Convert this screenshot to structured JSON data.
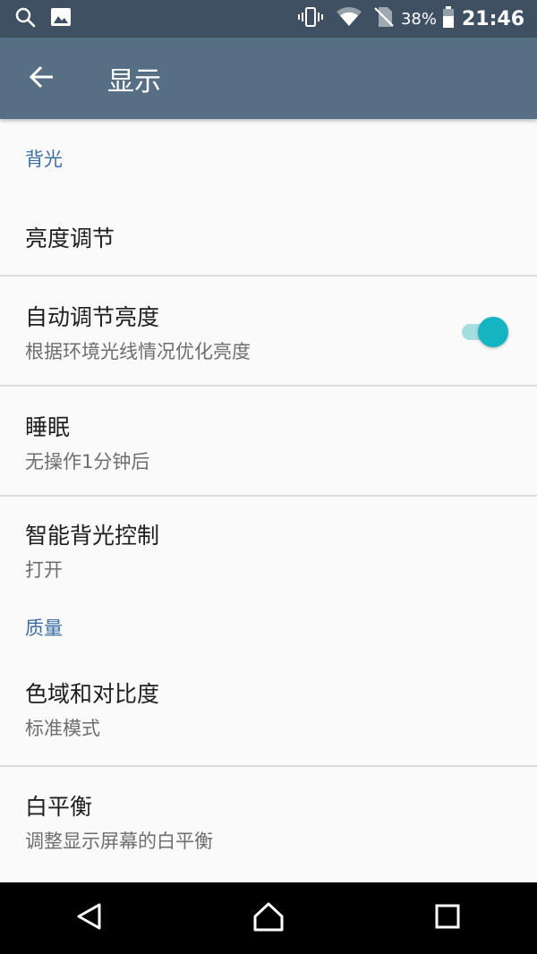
{
  "status_bar": {
    "battery_percent": "38%",
    "time": "21:46",
    "icons": [
      "search-icon",
      "image-icon",
      "vibrate-icon",
      "wifi-icon",
      "no-sim-icon",
      "battery-icon"
    ]
  },
  "app_bar": {
    "title": "显示",
    "back_icon": "arrow-back-icon"
  },
  "sections": {
    "backlight": {
      "header": "背光",
      "brightness": {
        "title": "亮度调节"
      },
      "auto_brightness": {
        "title": "自动调节亮度",
        "subtitle": "根据环境光线情况优化亮度",
        "enabled": true
      },
      "sleep": {
        "title": "睡眠",
        "subtitle": "无操作1分钟后"
      },
      "smart_backlight": {
        "title": "智能背光控制",
        "subtitle": "打开"
      }
    },
    "quality": {
      "header": "质量",
      "gamut": {
        "title": "色域和对比度",
        "subtitle": "标准模式"
      },
      "white_balance": {
        "title": "白平衡",
        "subtitle": "调整显示屏幕的白平衡"
      }
    }
  },
  "nav_bar": {
    "icons": [
      "back-triangle-icon",
      "home-icon",
      "recents-icon"
    ]
  },
  "colors": {
    "status_bar": "#3e5062",
    "app_bar": "#566f85",
    "section_header": "#3a6ea5",
    "toggle_thumb": "#14b4c2",
    "toggle_track": "#a5dde1",
    "background": "#fafafa"
  }
}
